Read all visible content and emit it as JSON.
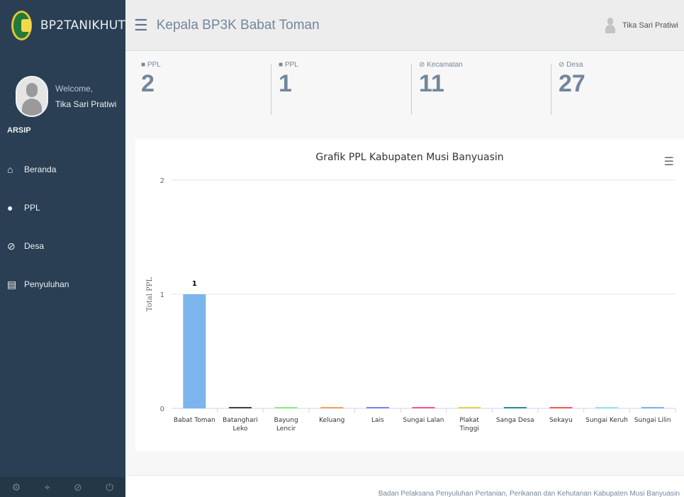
{
  "brand": {
    "name": "BP2TANIKHUT"
  },
  "profile": {
    "welcome": "Welcome,",
    "name": "Tika Sari Pratiwi"
  },
  "sidebar": {
    "section": "ARSIP",
    "items": [
      {
        "label": "Beranda",
        "icon": "home-icon"
      },
      {
        "label": "PPL",
        "icon": "user-icon"
      },
      {
        "label": "Desa",
        "icon": "compass-icon"
      },
      {
        "label": "Penyuluhan",
        "icon": "server-icon"
      }
    ],
    "footer_icons": [
      "settings-icon",
      "fullscreen-icon",
      "lock-icon",
      "logout-icon"
    ]
  },
  "topbar": {
    "title": "Kepala BP3K Babat Toman",
    "user": "Tika Sari Pratiwi"
  },
  "stats": [
    {
      "label": "PPL",
      "value": "2",
      "icon": "user-icon"
    },
    {
      "label": "PPL",
      "value": "1",
      "icon": "user-icon"
    },
    {
      "label": "Kecamatan",
      "value": "11",
      "icon": "compass-icon"
    },
    {
      "label": "Desa",
      "value": "27",
      "icon": "compass-icon"
    }
  ],
  "chart_data": {
    "type": "bar",
    "title": "Grafik PPL Kabupaten Musi Banyuasin",
    "ylabel": "Total PPL",
    "ylim": [
      0,
      2
    ],
    "yticks": [
      0,
      1,
      2
    ],
    "categories": [
      "Babat Toman",
      "Batanghari Leko",
      "Bayung Lencir",
      "Keluang",
      "Lais",
      "Sungai Lalan",
      "Plakat Tinggi",
      "Sanga Desa",
      "Sekayu",
      "Sungai Keruh",
      "Sungai Lilin"
    ],
    "values": [
      1,
      0,
      0,
      0,
      0,
      0,
      0,
      0,
      0,
      0,
      0
    ],
    "data_labels": [
      "1",
      "",
      "",
      "",
      "",
      "",
      "",
      "",
      "",
      "",
      ""
    ],
    "colors": [
      "#7cb5ec",
      "#434348",
      "#90ed7d",
      "#f7a35c",
      "#8085e9",
      "#f15c80",
      "#e4d354",
      "#2b908f",
      "#f45b5b",
      "#91e8e1",
      "#7cb5ec"
    ],
    "grid": true
  },
  "footer": {
    "text": "Badan Pelaksana Penyuluhan Pertanian, Perikanan dan Kehutanan Kabupaten Musi Banyuasin"
  }
}
